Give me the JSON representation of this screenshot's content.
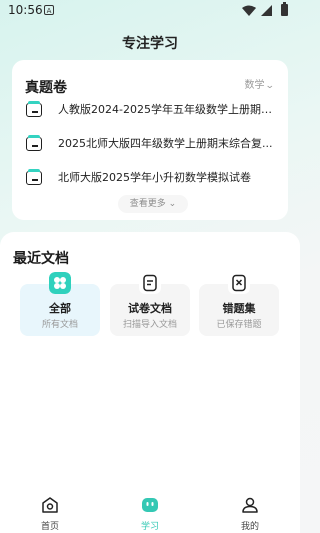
{
  "status_bar": {
    "time": "10:56",
    "notification_letter": "A"
  },
  "page_title": "专注学习",
  "exam_section": {
    "title": "真题卷",
    "subject": "数学",
    "items": [
      "人教版2024-2025学年五年级数学上册期中...",
      "2025北师大版四年级数学上册期末综合复...",
      "北师大版2025学年小升初数学模拟试卷"
    ],
    "more_label": "查看更多"
  },
  "docs_section": {
    "title": "最近文档",
    "tiles": [
      {
        "label": "全部",
        "sub": "所有文档",
        "icon": "grid-icon"
      },
      {
        "label": "试卷文档",
        "sub": "扫描导入文档",
        "icon": "document-icon"
      },
      {
        "label": "错题集",
        "sub": "已保存错题",
        "icon": "mistake-icon"
      }
    ]
  },
  "tabbar": {
    "items": [
      {
        "label": "首页",
        "icon": "home-icon"
      },
      {
        "label": "学习",
        "icon": "study-icon"
      },
      {
        "label": "我的",
        "icon": "profile-icon"
      }
    ],
    "active_index": 1
  },
  "colors": {
    "accent": "#34c8b4",
    "active_tile_bg": "#e8f6fc"
  }
}
